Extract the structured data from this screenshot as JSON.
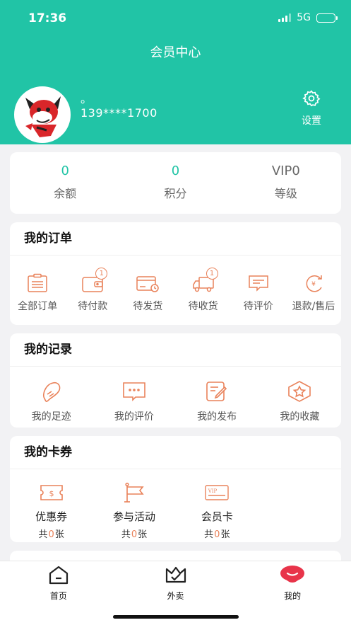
{
  "status_bar": {
    "time": "17:36",
    "network": "5G"
  },
  "header": {
    "title": "会员中心"
  },
  "profile": {
    "nickname": "。",
    "phone": "139****1700",
    "settings_label": "设置"
  },
  "stats": [
    {
      "value": "0",
      "label": "余额"
    },
    {
      "value": "0",
      "label": "积分"
    },
    {
      "value": "VIP0",
      "label": "等级"
    }
  ],
  "orders": {
    "title": "我的订单",
    "items": [
      {
        "label": "全部订单",
        "icon": "clipboard-icon"
      },
      {
        "label": "待付款",
        "icon": "wallet-icon",
        "badge": "1"
      },
      {
        "label": "待发货",
        "icon": "card-clock-icon"
      },
      {
        "label": "待收货",
        "icon": "truck-icon",
        "badge": "1"
      },
      {
        "label": "待评价",
        "icon": "comment-icon"
      },
      {
        "label": "退款/售后",
        "icon": "refund-icon"
      }
    ]
  },
  "records": {
    "title": "我的记录",
    "items": [
      {
        "label": "我的足迹",
        "icon": "footprint-icon"
      },
      {
        "label": "我的评价",
        "icon": "comment-dots-icon"
      },
      {
        "label": "我的发布",
        "icon": "edit-icon"
      },
      {
        "label": "我的收藏",
        "icon": "star-icon"
      }
    ]
  },
  "coupons": {
    "title": "我的卡券",
    "count_prefix": "共",
    "count_suffix": "张",
    "items": [
      {
        "label": "优惠券",
        "count": "0",
        "icon": "coupon-icon"
      },
      {
        "label": "参与活动",
        "count": "0",
        "icon": "flag-icon"
      },
      {
        "label": "会员卡",
        "count": "0",
        "icon": "vip-card-icon"
      }
    ]
  },
  "tabbar": [
    {
      "label": "首页",
      "icon": "home-icon"
    },
    {
      "label": "外卖",
      "icon": "crown-icon"
    },
    {
      "label": "我的",
      "icon": "profile-icon"
    }
  ],
  "colors": {
    "primary": "#21c4a6",
    "accent": "#e9825a",
    "mine": "#e8344a"
  }
}
